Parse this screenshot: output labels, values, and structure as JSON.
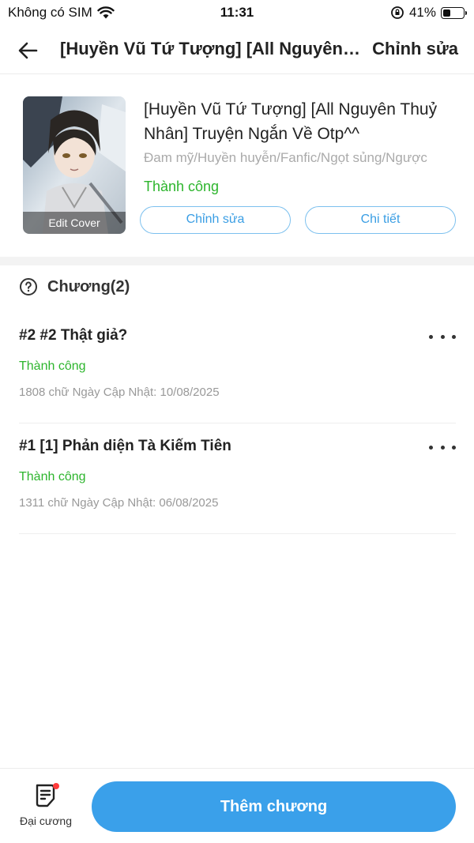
{
  "status_bar": {
    "carrier": "Không có SIM",
    "time": "11:31",
    "battery": "41%",
    "battery_level": 0.41
  },
  "nav": {
    "back_icon": "arrow-left-icon",
    "title": "[Huyền Vũ Tứ Tượng] [All Nguyên Thuỷ Nhân] Truyện Ngắn Về Otp^^",
    "edit_label": "Chỉnh sửa"
  },
  "book": {
    "cover_label": "Edit Cover",
    "title": "[Huyền Vũ Tứ Tượng] [All Nguyên Thuỷ Nhân] Truyện Ngắn Về Otp^^",
    "genres": "Đam mỹ/Huyền huyễn/Fanfic/Ngọt sủng/Ngược",
    "status": "Thành công",
    "edit_button": "Chỉnh sửa",
    "detail_button": "Chi tiết"
  },
  "chapters": {
    "header": "Chương(2)",
    "items": [
      {
        "title": "#2 #2 Thật giả?",
        "status": "Thành công",
        "meta": "1808 chữ Ngày Cập Nhật: 10/08/2025"
      },
      {
        "title": "#1 [1] Phản diện Tà Kiếm Tiên",
        "status": "Thành công",
        "meta": "1311 chữ Ngày Cập Nhật: 06/08/2025"
      }
    ]
  },
  "bottom": {
    "outline_label": "Đại cương",
    "add_chapter_label": "Thêm chương"
  },
  "colors": {
    "accent": "#3aa0ea",
    "success": "#2db52d",
    "pill_border": "#7cc0ee"
  }
}
